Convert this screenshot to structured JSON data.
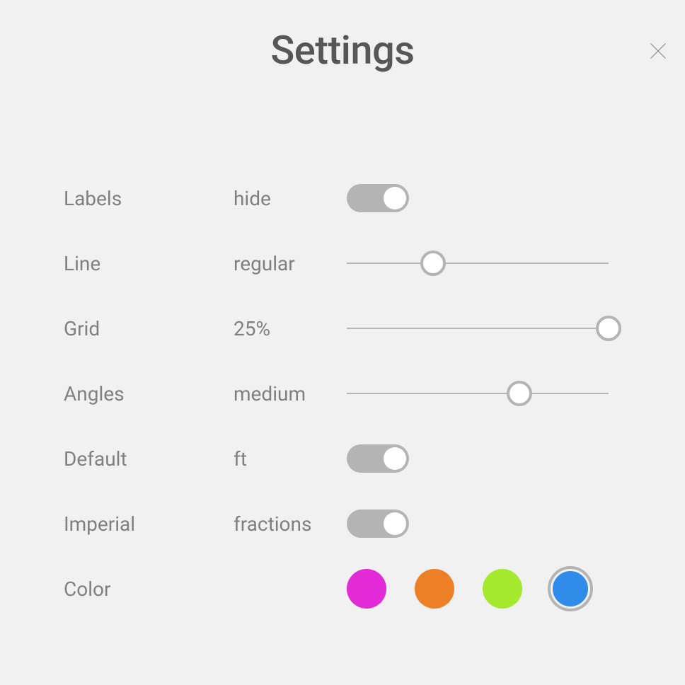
{
  "title": "Settings",
  "rows": {
    "labels": {
      "label": "Labels",
      "value": "hide"
    },
    "line": {
      "label": "Line",
      "value": "regular",
      "slider_percent": 33
    },
    "grid": {
      "label": "Grid",
      "value": "25%",
      "slider_percent": 100
    },
    "angles": {
      "label": "Angles",
      "value": "medium",
      "slider_percent": 66
    },
    "default": {
      "label": "Default",
      "value": "ft"
    },
    "imperial": {
      "label": "Imperial",
      "value": "fractions"
    },
    "color": {
      "label": "Color"
    }
  },
  "colors": [
    {
      "name": "magenta",
      "hex": "#e22bd6",
      "selected": false
    },
    {
      "name": "orange",
      "hex": "#ed8026",
      "selected": false
    },
    {
      "name": "lime",
      "hex": "#a4e92e",
      "selected": false
    },
    {
      "name": "blue",
      "hex": "#2f8ce8",
      "selected": true
    }
  ]
}
